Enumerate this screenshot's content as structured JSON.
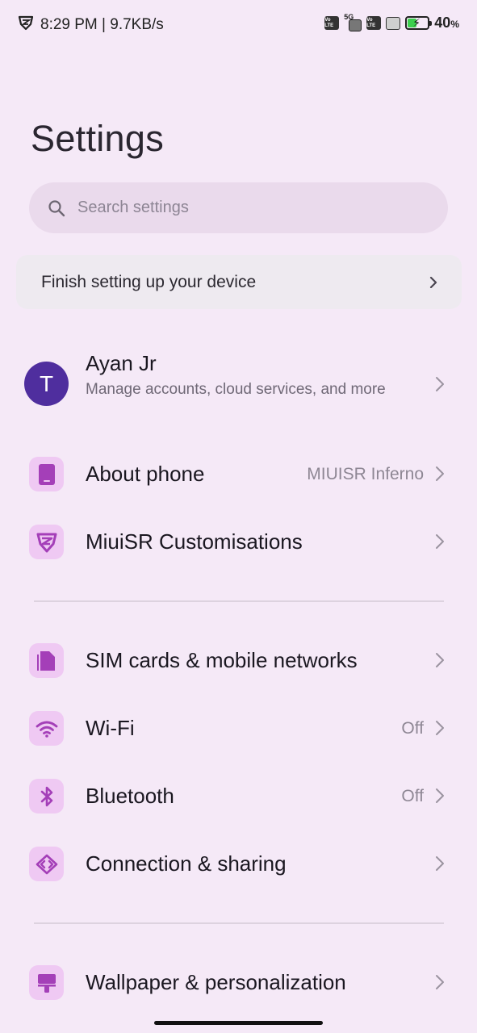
{
  "status_bar": {
    "time_speed": "8:29 PM | 9.7KB/s",
    "volte_text": "Vo LTE",
    "net_5g": "5G",
    "battery_percent": "40",
    "battery_unit": "%",
    "battery_level": 0.4
  },
  "header": {
    "title": "Settings"
  },
  "search": {
    "placeholder": "Search settings"
  },
  "setup_card": {
    "label": "Finish setting up your device"
  },
  "account": {
    "avatar_letter": "T",
    "name": "Ayan Jr",
    "subtitle": "Manage accounts, cloud services, and more"
  },
  "rows": {
    "about": {
      "title": "About phone",
      "value": "MIUISR Inferno",
      "icon": "phone-icon"
    },
    "miuisr": {
      "title": "MiuiSR Customisations",
      "icon": "miuisr-logo-icon"
    },
    "sim": {
      "title": "SIM cards & mobile networks",
      "icon": "sim-card-icon"
    },
    "wifi": {
      "title": "Wi-Fi",
      "value": "Off",
      "icon": "wifi-icon"
    },
    "bluetooth": {
      "title": "Bluetooth",
      "value": "Off",
      "icon": "bluetooth-icon"
    },
    "connection": {
      "title": "Connection & sharing",
      "icon": "connection-sharing-icon"
    },
    "wallpaper": {
      "title": "Wallpaper & personalization",
      "icon": "wallpaper-icon"
    }
  },
  "colors": {
    "background": "#f5e9f7",
    "icon_tile": "#efc9f3",
    "icon_glyph": "#a43fb8",
    "avatar": "#4f2e9e"
  }
}
